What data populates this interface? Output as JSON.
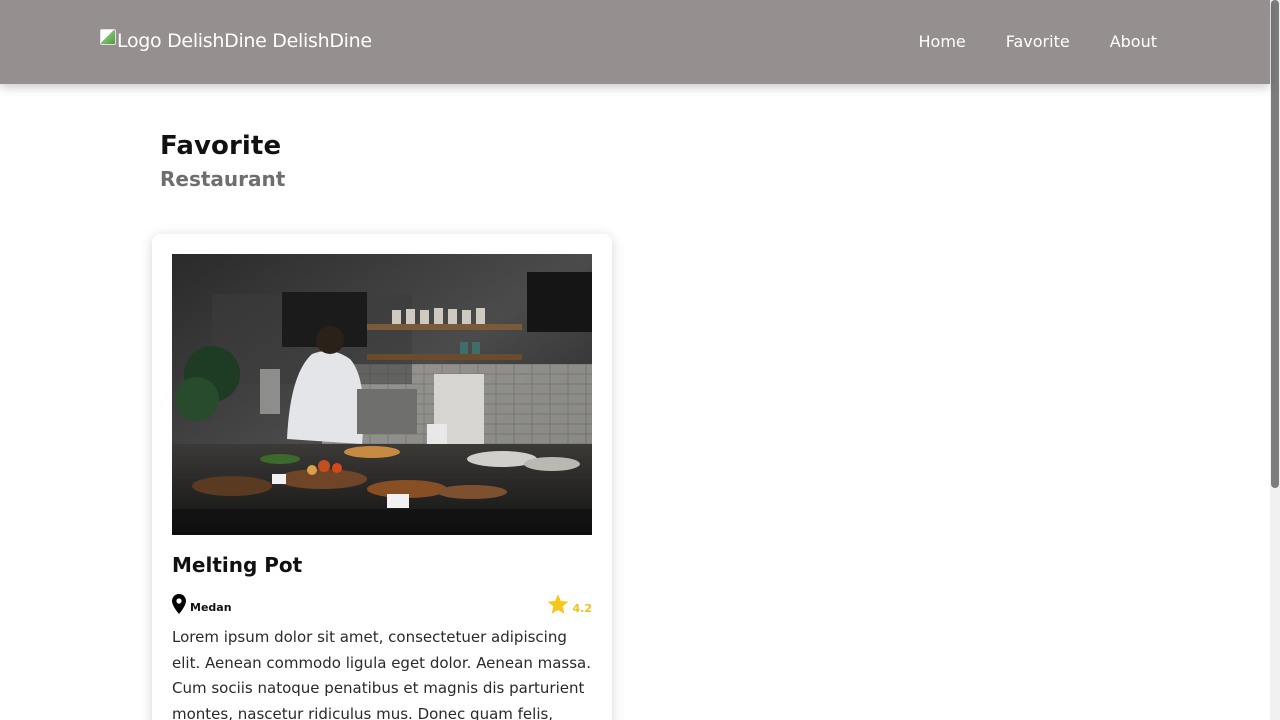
{
  "navbar": {
    "brand_text": "Logo DelishDine DelishDine",
    "links": [
      "Home",
      "Favorite",
      "About"
    ],
    "background": "#958f8f"
  },
  "page": {
    "title": "Favorite",
    "subtitle": "Restaurant"
  },
  "restaurant": {
    "name": "Melting Pot",
    "city": "Medan",
    "rating": "4.2",
    "description": "Lorem ipsum dolor sit amet, consectetuer adipiscing elit. Aenean commodo ligula eget dolor. Aenean massa. Cum sociis natoque penatibus et magnis dis parturient montes, nascetur ridiculus mus. Donec quam felis,",
    "icons": {
      "location": "map-pin-icon",
      "rating": "star-icon"
    },
    "rating_color": "#f3bf1a"
  }
}
